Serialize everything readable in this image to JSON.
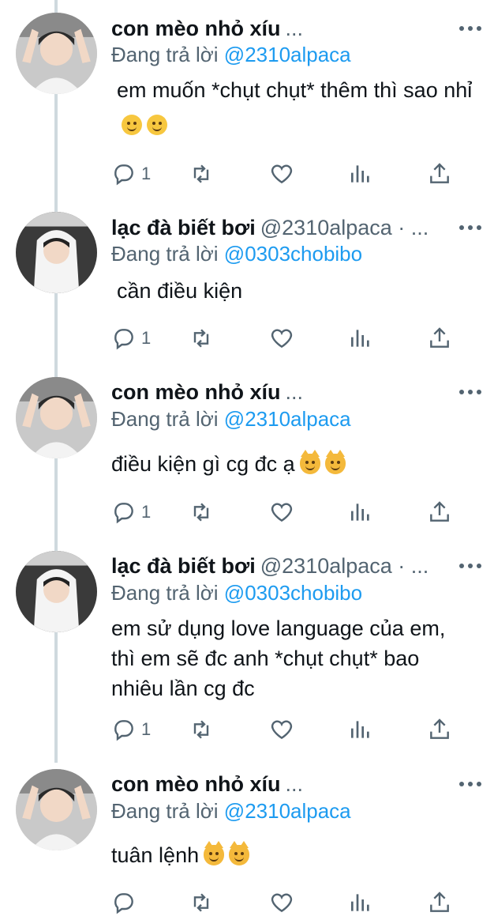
{
  "tweets": [
    {
      "author": "con mèo nhỏ xíu",
      "handle": "",
      "trail": "...",
      "reply_prefix": "Đang trả lời",
      "reply_to": "@2310alpaca",
      "text": "em muốn *chụt chụt* thêm thì sao nhỉ",
      "emojis": [
        "face-with-raised-eyebrow-emoji",
        "face-with-raised-eyebrow-emoji"
      ],
      "reply_count": "1"
    },
    {
      "author": "lạc đà biết bơi",
      "handle": "@2310alpaca · ...",
      "trail": "",
      "reply_prefix": "Đang trả lời",
      "reply_to": "@0303chobibo",
      "text": "cần điều kiện",
      "emojis": [],
      "reply_count": "1"
    },
    {
      "author": "con mèo nhỏ xíu",
      "handle": "",
      "trail": "...",
      "reply_prefix": "Đang trả lời",
      "reply_to": "@2310alpaca",
      "text": "điều kiện gì cg đc ạ",
      "emojis": [
        "grinning-cat-emoji",
        "grinning-cat-emoji"
      ],
      "reply_count": "1"
    },
    {
      "author": "lạc đà biết bơi",
      "handle": "@2310alpaca · ...",
      "trail": "",
      "reply_prefix": "Đang trả lời",
      "reply_to": "@0303chobibo",
      "text": "em sử dụng love language của em, thì em sẽ đc anh *chụt chụt* bao nhiêu lần cg đc",
      "emojis": [],
      "reply_count": "1"
    },
    {
      "author": "con mèo nhỏ xíu",
      "handle": "",
      "trail": "...",
      "reply_prefix": "Đang trả lời",
      "reply_to": "@2310alpaca",
      "text": "tuân lệnh",
      "emojis": [
        "grinning-cat-emoji",
        "grinning-cat-emoji"
      ],
      "reply_count": ""
    }
  ],
  "colors": {
    "link": "#1d9bf0",
    "secondary": "#536471",
    "text": "#0f1419",
    "thread_line": "#cfd9de"
  }
}
